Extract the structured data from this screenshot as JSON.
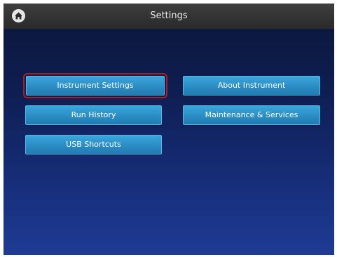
{
  "header": {
    "title": "Settings",
    "home_icon": "home-icon"
  },
  "menu": {
    "instrument_settings": "Instrument Settings",
    "about_instrument": "About Instrument",
    "run_history": "Run History",
    "maintenance_services": "Maintenance & Services",
    "usb_shortcuts": "USB Shortcuts",
    "selected": "Instrument Settings"
  },
  "colors": {
    "header_bg": "#333333",
    "button_blue": "#2b8dc4",
    "selection_outline": "#b01c24",
    "background_top": "#0a1638",
    "background_bottom": "#1e3b94"
  }
}
